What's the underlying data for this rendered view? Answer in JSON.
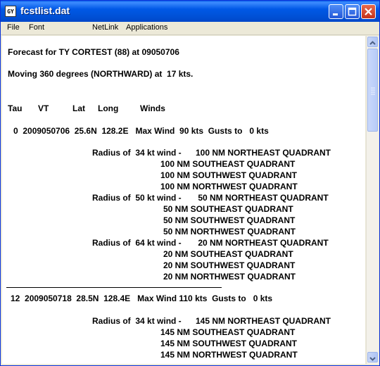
{
  "window": {
    "title": "fcstlist.dat",
    "icon_glyph": "GY"
  },
  "menu": {
    "items": [
      "File",
      "Font",
      "NetLink",
      "Applications"
    ]
  },
  "report": {
    "header": "Forecast for TY CORTEST (88) at 09050706",
    "motion": "Moving 360 degrees (NORTHWARD) at  17 kts.",
    "columns": {
      "tau": "Tau",
      "vt": "VT",
      "lat": "Lat",
      "long": "Long",
      "winds": "Winds"
    },
    "entries": [
      {
        "summary": "0  2009050706  25.6N  128.2E   Max Wind  90 kts  Gusts to   0 kts",
        "radii": [
          {
            "label": "Radius of  34 kt wind -",
            "quadrants": [
              "100 NM NORTHEAST QUADRANT",
              "100 NM SOUTHEAST QUADRANT",
              "100 NM SOUTHWEST QUADRANT",
              "100 NM NORTHWEST QUADRANT"
            ]
          },
          {
            "label": "Radius of  50 kt wind -",
            "quadrants": [
              " 50 NM NORTHEAST QUADRANT",
              "50 NM SOUTHEAST QUADRANT",
              "50 NM SOUTHWEST QUADRANT",
              "50 NM NORTHWEST QUADRANT"
            ]
          },
          {
            "label": "Radius of  64 kt wind -",
            "quadrants": [
              " 20 NM NORTHEAST QUADRANT",
              "20 NM SOUTHEAST QUADRANT",
              "20 NM SOUTHWEST QUADRANT",
              "20 NM NORTHWEST QUADRANT"
            ]
          }
        ]
      },
      {
        "summary": "12  2009050718  28.5N  128.4E   Max Wind 110 kts  Gusts to   0 kts",
        "radii": [
          {
            "label": "Radius of  34 kt wind -",
            "quadrants": [
              "145 NM NORTHEAST QUADRANT",
              "145 NM SOUTHEAST QUADRANT",
              "145 NM SOUTHWEST QUADRANT",
              "145 NM NORTHWEST QUADRANT"
            ]
          }
        ]
      }
    ]
  },
  "scrollbar": {
    "up_icon": "arrow-up-icon",
    "down_icon": "arrow-down-icon"
  },
  "controls": {
    "minimize_icon": "minimize-icon",
    "maximize_icon": "maximize-icon",
    "close_icon": "close-icon"
  }
}
